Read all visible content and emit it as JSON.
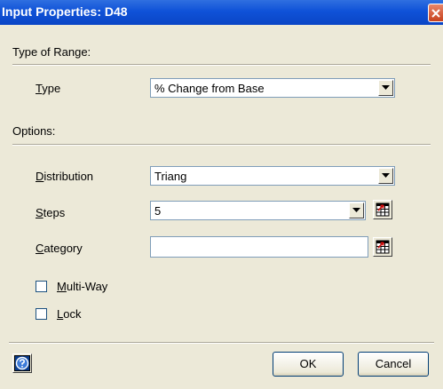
{
  "window": {
    "title": "Input Properties: D48",
    "close_icon": "close-icon"
  },
  "type_of_range": {
    "section_label": "Type of Range:",
    "type_label_accel": "T",
    "type_label_rest": "ype",
    "type_value": "% Change from Base"
  },
  "options": {
    "section_label": "Options:",
    "distribution_label_accel": "D",
    "distribution_label_rest": "istribution",
    "distribution_value": "Triang",
    "steps_label_accel": "S",
    "steps_label_rest": "teps",
    "steps_value": "5",
    "category_label_accel": "C",
    "category_label_rest": "ategory",
    "category_value": "",
    "multiway_label_accel": "M",
    "multiway_label_rest": "ulti-Way",
    "multiway_checked": false,
    "lock_label_accel": "L",
    "lock_label_rest": "ock",
    "lock_checked": false
  },
  "footer": {
    "ok_label": "OK",
    "cancel_label": "Cancel",
    "help_icon": "help-icon"
  },
  "colors": {
    "titlebar": "#0f52d8",
    "dialog_bg": "#ece9d8",
    "field_border": "#7f9db9"
  }
}
